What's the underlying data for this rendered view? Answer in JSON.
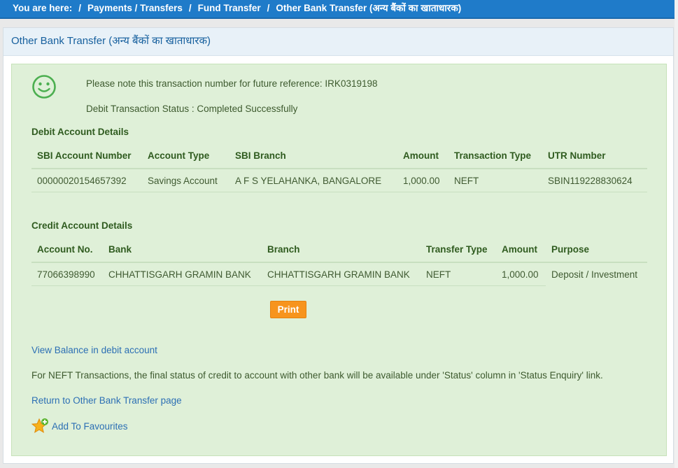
{
  "breadcrumb": {
    "prefix": "You are here:",
    "items": [
      "Payments / Transfers",
      "Fund Transfer",
      "Other Bank Transfer (अन्य बैंकों का खाताधारक)"
    ]
  },
  "panel": {
    "title": "Other Bank Transfer (अन्य बैंकों का खाताधारक)"
  },
  "status": {
    "icon": "smiley-icon",
    "reference_note": "Please note this transaction number for future reference: IRK0319198",
    "debit_status": "Debit Transaction Status : Completed Successfully"
  },
  "debit": {
    "title": "Debit Account Details",
    "headers": [
      "SBI Account Number",
      "Account Type",
      "SBI Branch",
      "Amount",
      "Transaction Type",
      "UTR Number"
    ],
    "row": [
      "00000020154657392",
      "Savings Account",
      "A F S YELAHANKA, BANGALORE",
      "1,000.00",
      "NEFT",
      "SBIN119228830624"
    ]
  },
  "credit": {
    "title": "Credit Account Details",
    "headers": [
      "Account No.",
      "Bank",
      "Branch",
      "Transfer Type",
      "Amount",
      "Purpose"
    ],
    "row": [
      "77066398990",
      "CHHATTISGARH GRAMIN BANK",
      "CHHATTISGARH GRAMIN BANK",
      "NEFT",
      "1,000.00",
      "Deposit / Investment"
    ]
  },
  "actions": {
    "print_label": "Print",
    "view_balance": "View Balance in debit account",
    "neft_note": "For NEFT Transactions, the final status of credit to account with other bank will be available under 'Status' column in 'Status Enquiry' link.",
    "return_link": "Return to Other Bank Transfer page",
    "favourites": "Add To Favourites"
  },
  "colors": {
    "header_bar": "#1f7bc9",
    "success_box": "#dff0d8",
    "print_button": "#f7941d",
    "link": "#2c6fb4"
  }
}
